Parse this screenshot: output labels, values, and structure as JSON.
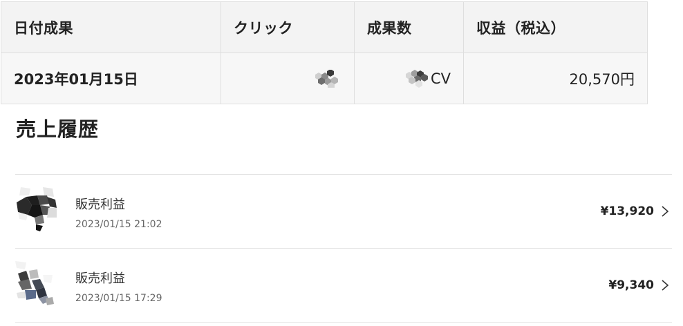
{
  "table": {
    "headers": [
      "日付成果",
      "クリック",
      "成果数",
      "収益（税込）"
    ],
    "row": {
      "date": "2023年01月15日",
      "cv_suffix": "CV",
      "revenue": "20,570円"
    }
  },
  "sales_history": {
    "title": "売上履歴",
    "items": [
      {
        "title": "販売利益",
        "datetime": "2023/01/15 21:02",
        "amount": "¥13,920"
      },
      {
        "title": "販売利益",
        "datetime": "2023/01/15 17:29",
        "amount": "¥9,340"
      }
    ]
  },
  "icons": {
    "masked_value": "mosaic-icon",
    "row_link": "chevron-right-icon"
  },
  "colors": {
    "header_bg": "#f3f3f3",
    "row_bg": "#f7f7f7",
    "border": "#dedede",
    "text": "#222222"
  }
}
